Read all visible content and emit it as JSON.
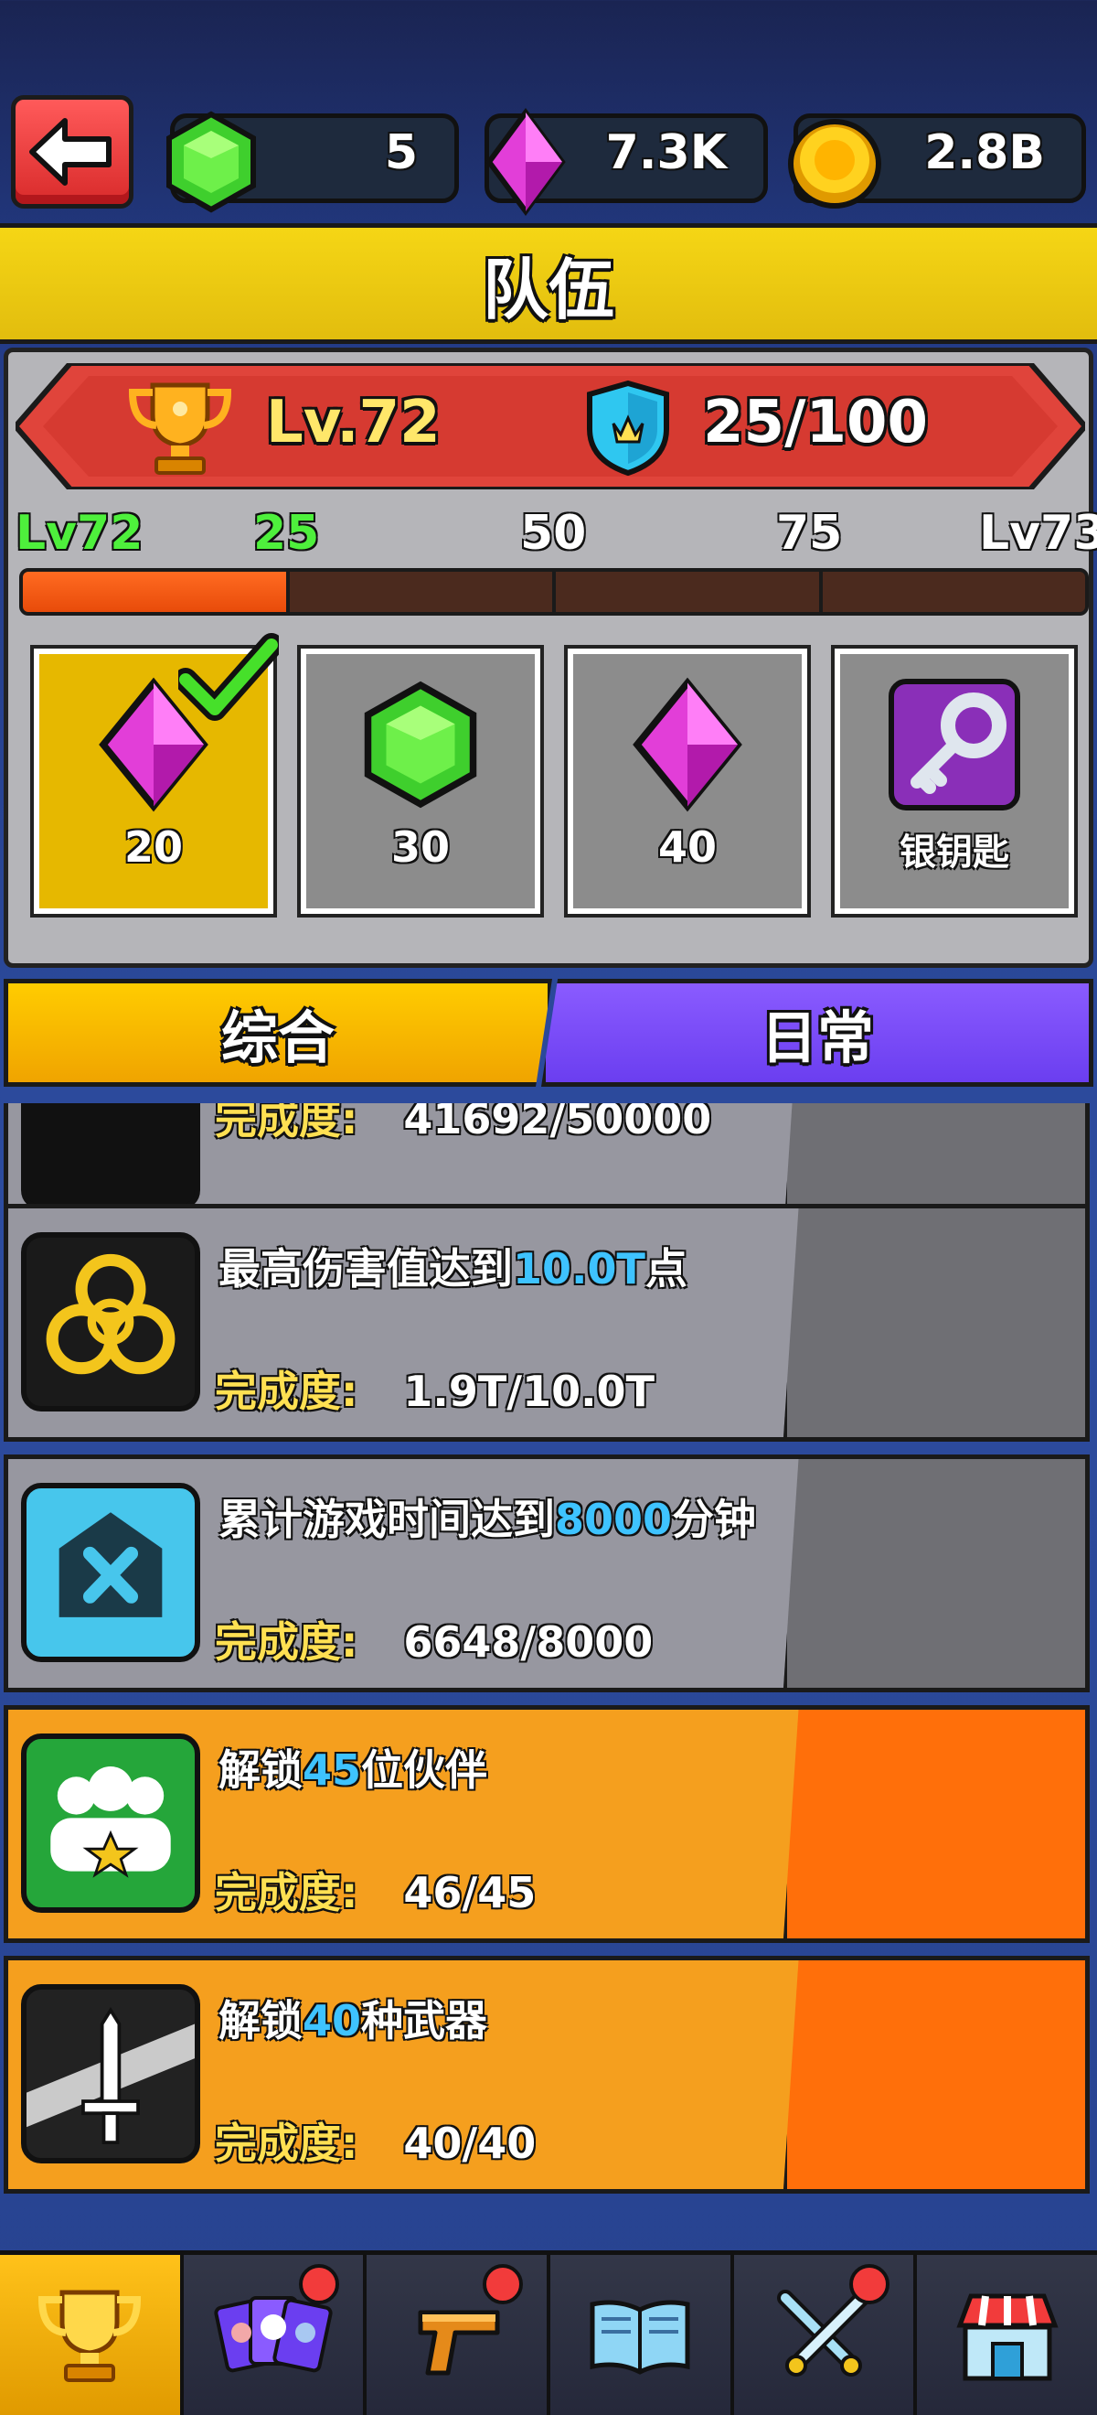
{
  "currencies": {
    "gems_green": "5",
    "gems_pink": "7.3K",
    "coins": "2.8B"
  },
  "title": "队伍",
  "level": {
    "current": "Lv.72",
    "points": "25/100",
    "markers": [
      "Lv72",
      "25",
      "50",
      "75",
      "Lv73"
    ],
    "progress_fraction": 0.25
  },
  "rewards": [
    {
      "label": "20",
      "icon": "pink-gem-icon",
      "claimed": true
    },
    {
      "label": "30",
      "icon": "green-gem-icon",
      "claimed": false
    },
    {
      "label": "40",
      "icon": "pink-gem-icon",
      "claimed": false
    },
    {
      "label": "银钥匙",
      "icon": "silver-key-icon",
      "claimed": false
    }
  ],
  "tabs": [
    "综合",
    "日常"
  ],
  "tasks": [
    {
      "name": "",
      "progress_label": "完成度:",
      "progress_value": "41692/50000",
      "done": false
    },
    {
      "name_pre": "最高伤害值达到",
      "name_hl": "10.0T",
      "name_post": "点",
      "progress_label": "完成度:",
      "progress_value": "1.9T/10.0T",
      "done": false
    },
    {
      "name_pre": "累计游戏时间达到",
      "name_hl": "8000",
      "name_post": "分钟",
      "progress_label": "完成度:",
      "progress_value": "6648/8000",
      "done": false
    },
    {
      "name_pre": "解锁",
      "name_hl": "45",
      "name_post": "位伙伴",
      "progress_label": "完成度:",
      "progress_value": "46/45",
      "done": true
    },
    {
      "name_pre": "解锁",
      "name_hl": "40",
      "name_post": "种武器",
      "progress_label": "完成度:",
      "progress_value": "40/40",
      "done": true
    }
  ],
  "bottom_nav": [
    "trophy-icon",
    "cards-icon",
    "pistol-icon",
    "book-icon",
    "swords-icon",
    "shop-icon"
  ],
  "colors": {
    "accent_yellow": "#f5d615",
    "progress_orange": "#ff6b21",
    "tab_purple": "#7a4af5",
    "highlight_blue": "#3ec3ff"
  }
}
